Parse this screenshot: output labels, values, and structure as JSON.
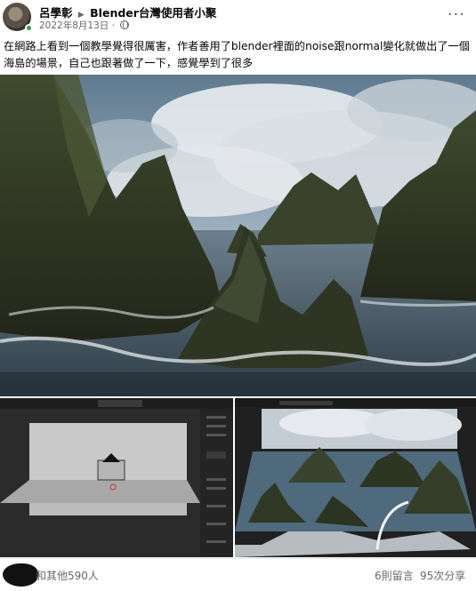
{
  "post": {
    "author": "呂學彰",
    "group": "Blender台灣使用者小聚",
    "date": "2022年8月13日",
    "more_icon": "ellipsis-icon",
    "text": "在網路上看到一個教學覺得很厲害，作者善用了blender裡面的noise跟normal變化就做出了一個海島的場景，自己也跟著做了一下，感覺學到了很多"
  },
  "media": {
    "hero": "rendered-island-scene",
    "left_thumb": "blender-viewport-screenshot",
    "right_thumb": "island-render-preview"
  },
  "footer": {
    "likes": "和其他590人",
    "comments": "6則留言",
    "shares": "95次分享"
  },
  "colors": {
    "text": "#050505",
    "secondary": "#65676b",
    "online": "#31a24c"
  }
}
